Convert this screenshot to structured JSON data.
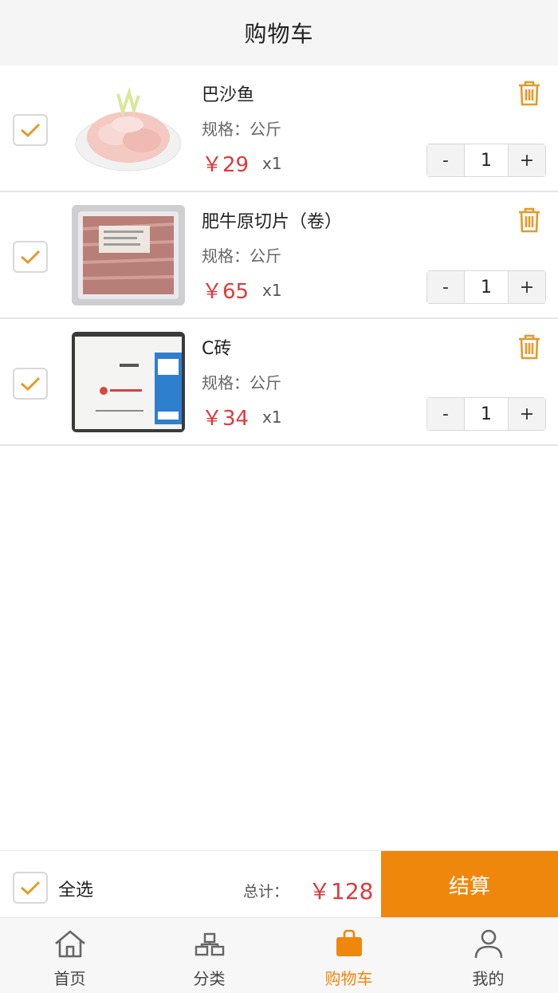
{
  "header": {
    "title": "购物车"
  },
  "items": [
    {
      "name": "巴沙鱼",
      "spec": "规格：公斤",
      "price": "￥29",
      "qty_label": "x1",
      "quantity": "1",
      "minus": "-",
      "plus": "+"
    },
    {
      "name": "肥牛原切片（卷）",
      "spec": "规格：公斤",
      "price": "￥65",
      "qty_label": "x1",
      "quantity": "1",
      "minus": "-",
      "plus": "+"
    },
    {
      "name": "C砖",
      "spec": "规格：公斤",
      "price": "￥34",
      "qty_label": "x1",
      "quantity": "1",
      "minus": "-",
      "plus": "+"
    }
  ],
  "footer": {
    "select_all": "全选",
    "total_label": "总计：",
    "total_value": "￥128",
    "checkout": "结算"
  },
  "tabs": [
    {
      "label": "首页",
      "icon": "home-icon"
    },
    {
      "label": "分类",
      "icon": "category-icon"
    },
    {
      "label": "购物车",
      "icon": "shopping-bag-icon",
      "active": true
    },
    {
      "label": "我的",
      "icon": "user-icon"
    }
  ],
  "colors": {
    "accent": "#f0870d",
    "price": "#e0393b"
  }
}
